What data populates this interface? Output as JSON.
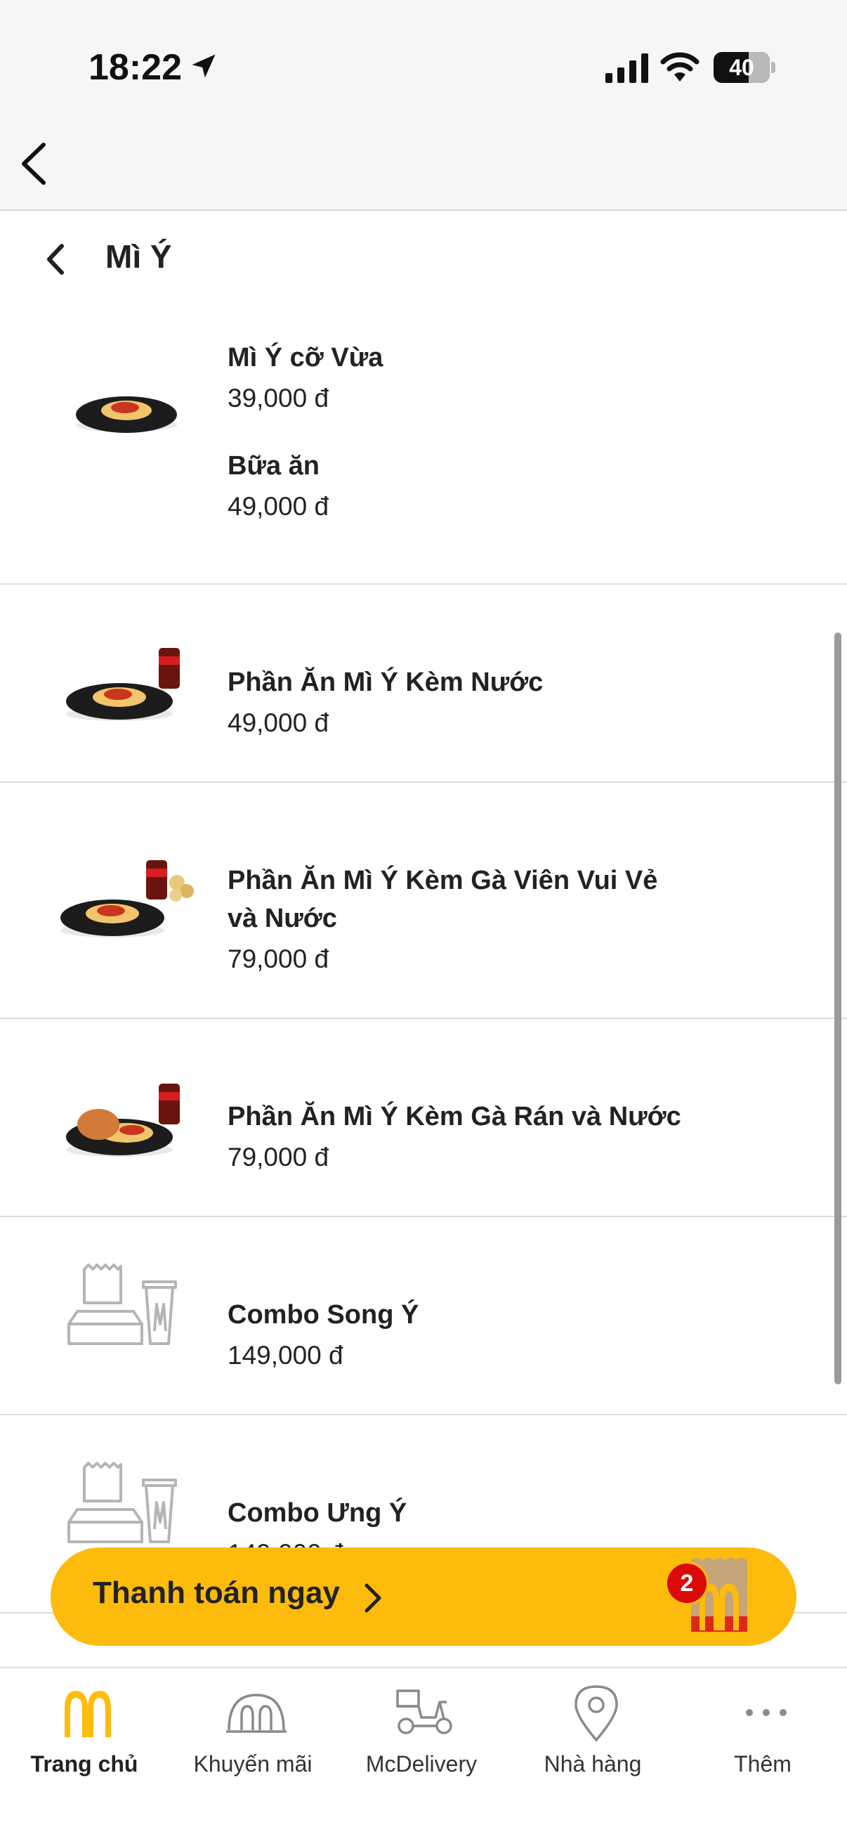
{
  "status_bar": {
    "time": "18:22",
    "battery": "40"
  },
  "section": {
    "title": "Mì Ý"
  },
  "items": [
    {
      "options": [
        {
          "name": "Mì Ý cỡ Vừa",
          "price": "39,000 đ"
        },
        {
          "name": "Bữa ăn",
          "price": "49,000 đ"
        }
      ],
      "image": "spaghetti-plate-icon"
    },
    {
      "name": "Phần Ăn Mì Ý Kèm Nước",
      "price": "49,000 đ",
      "image": "spaghetti-drink-icon"
    },
    {
      "name_line1": "Phần Ăn Mì Ý Kèm Gà Viên Vui Vẻ",
      "name_line2": "và Nước",
      "price": "79,000 đ",
      "image": "spaghetti-nuggets-drink-icon"
    },
    {
      "name": "Phần Ăn Mì Ý Kèm Gà Rán và Nước",
      "price": "79,000 đ",
      "image": "spaghetti-chicken-drink-icon"
    },
    {
      "name": "Combo Song Ý",
      "price": "149,000 đ",
      "image": "combo-placeholder-icon"
    },
    {
      "name": "Combo Ưng Ý",
      "price": "149,000 đ",
      "image": "combo-placeholder-icon"
    }
  ],
  "checkout": {
    "label": "Thanh toán ngay",
    "cart_count": "2",
    "colors": {
      "button": "#fdbb0d",
      "badge": "#da0a0a",
      "brand_red": "#da291c",
      "brand_yellow": "#ffbc0d"
    }
  },
  "tabs": [
    {
      "label": "Trang chủ",
      "icon": "mcdonalds-arches-icon",
      "active": true
    },
    {
      "label": "Khuyến mãi",
      "icon": "promo-arches-icon",
      "active": false
    },
    {
      "label": "McDelivery",
      "icon": "delivery-scooter-icon",
      "active": false
    },
    {
      "label": "Nhà hàng",
      "icon": "location-pin-icon",
      "active": false
    },
    {
      "label": "Thêm",
      "icon": "more-dots-icon",
      "active": false
    }
  ]
}
